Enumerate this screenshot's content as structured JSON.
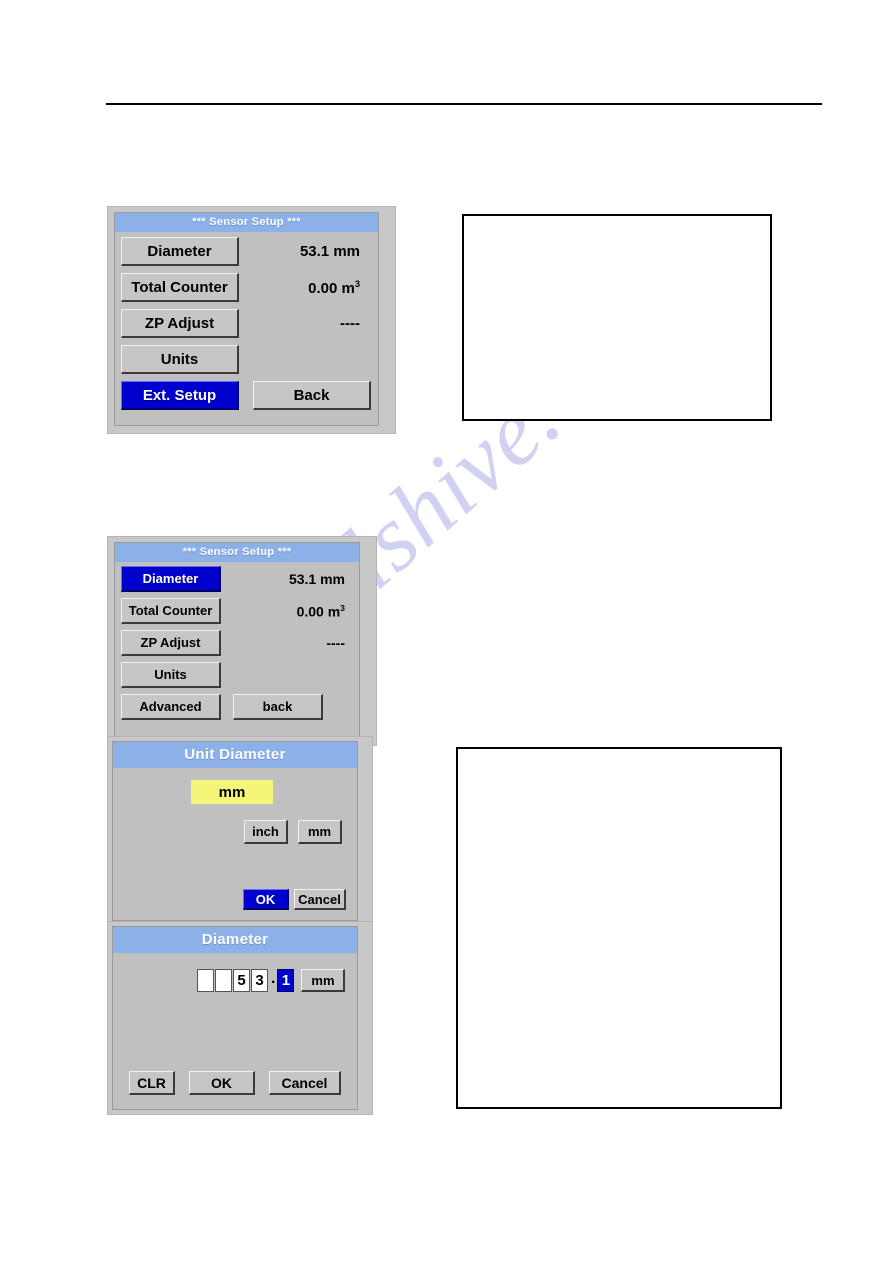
{
  "page": {
    "watermark_text": "manualshive.com",
    "background_color": "#ffffff",
    "rule_color": "#000000"
  },
  "theme": {
    "lcd_background": "#c0c0c0",
    "titlebar_blue": "#8cb0e8",
    "selected_blue": "#0000cc",
    "highlight_yellow": "#f5f57a",
    "bezel_gray": "#c8c8c8",
    "button_face": "#c6c6c6"
  },
  "panels": {
    "sensor_setup_ext": {
      "title": "***   Sensor Setup ***",
      "rows": [
        {
          "button": "Diameter",
          "selected": false,
          "value": "53.1 mm",
          "value_sup": ""
        },
        {
          "button": "Total Counter",
          "selected": false,
          "value": "0.00 m",
          "value_sup": "3"
        },
        {
          "button": "ZP Adjust",
          "selected": false,
          "value": "----",
          "value_sup": ""
        },
        {
          "button": "Units",
          "selected": false,
          "value": "",
          "value_sup": ""
        }
      ],
      "footer_primary": "Ext. Setup",
      "footer_primary_selected": true,
      "footer_secondary": "Back"
    },
    "sensor_setup_advanced": {
      "title": "***   Sensor Setup ***",
      "rows": [
        {
          "button": "Diameter",
          "selected": true,
          "value": "53.1 mm",
          "value_sup": ""
        },
        {
          "button": "Total Counter",
          "selected": false,
          "value": "0.00 m",
          "value_sup": "3"
        },
        {
          "button": "ZP Adjust",
          "selected": false,
          "value": "----",
          "value_sup": ""
        },
        {
          "button": "Units",
          "selected": false,
          "value": "",
          "value_sup": ""
        }
      ],
      "footer_primary": "Advanced",
      "footer_primary_selected": false,
      "footer_secondary": "back"
    },
    "unit_diameter": {
      "title": "Unit Diameter",
      "current_unit": "mm",
      "option_inch": "inch",
      "option_mm": "mm",
      "ok_label": "OK",
      "ok_selected": true,
      "cancel_label": "Cancel"
    },
    "diameter_entry": {
      "title": "Diameter",
      "digits": [
        {
          "char": "",
          "highlighted": false
        },
        {
          "char": "",
          "highlighted": false
        },
        {
          "char": "5",
          "highlighted": false
        },
        {
          "char": "3",
          "highlighted": false
        }
      ],
      "decimal_separator": ".",
      "decimal_digits": [
        {
          "char": "1",
          "highlighted": true
        }
      ],
      "unit_label": "mm",
      "clr_label": "CLR",
      "ok_label": "OK",
      "cancel_label": "Cancel"
    }
  },
  "noteboxes": [
    {
      "name": "note-box-top",
      "text": ""
    },
    {
      "name": "note-box-bottom",
      "text": ""
    }
  ]
}
